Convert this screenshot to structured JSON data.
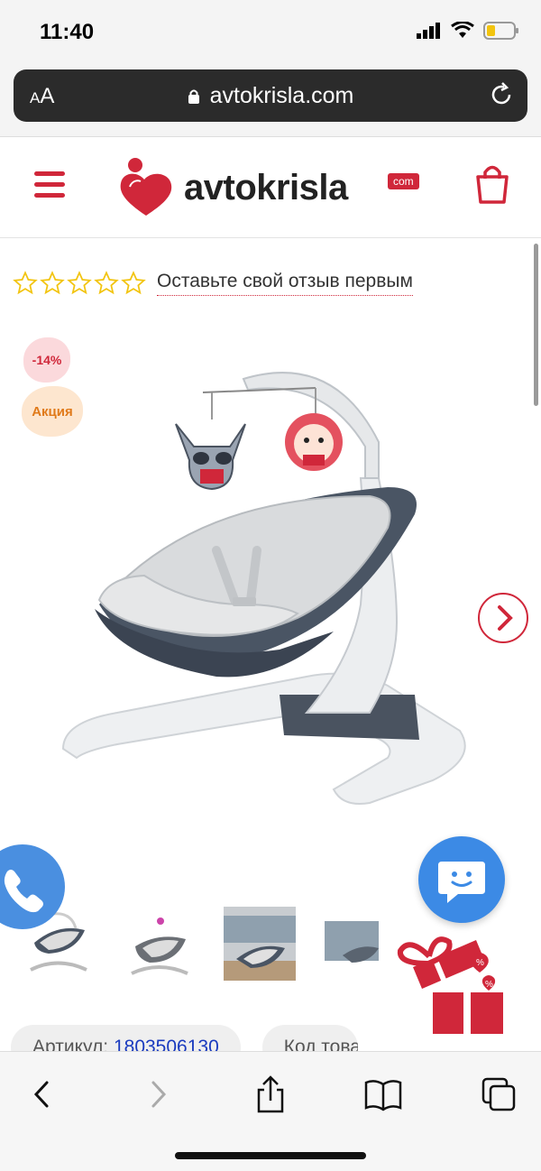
{
  "status_bar": {
    "time": "11:40",
    "icons": [
      "signal-icon",
      "wifi-icon",
      "battery-icon"
    ]
  },
  "url_bar": {
    "text_size_label": "AA",
    "url": "avtokrisla.com",
    "icons": [
      "lock-icon",
      "reload-icon"
    ]
  },
  "header": {
    "logo_text": "avtokrisla",
    "logo_badge": "com",
    "icons": [
      "menu-icon",
      "logo-heart-icon",
      "cart-icon"
    ]
  },
  "product": {
    "rating_stars": 0,
    "rating_max": 5,
    "review_link": "Оставьте свой отзыв первым",
    "badges": {
      "discount": "-14%",
      "sale": "Акция"
    },
    "thumbnail_count": 4,
    "info_chips": [
      {
        "label": "Артикул: ",
        "value": "1803506130"
      },
      {
        "label": "Код това",
        "value": ""
      }
    ]
  },
  "floating": {
    "icons": [
      "phone-icon",
      "chat-smile-icon",
      "gift-icon"
    ]
  },
  "browser_toolbar": {
    "icons": [
      "back-icon",
      "forward-icon",
      "share-icon",
      "bookmarks-icon",
      "tabs-icon"
    ]
  },
  "colors": {
    "brand_red": "#d0273a",
    "link_blue": "#1a3bbf",
    "chat_blue": "#3c8ae5",
    "star_yellow": "#f2c40f"
  }
}
